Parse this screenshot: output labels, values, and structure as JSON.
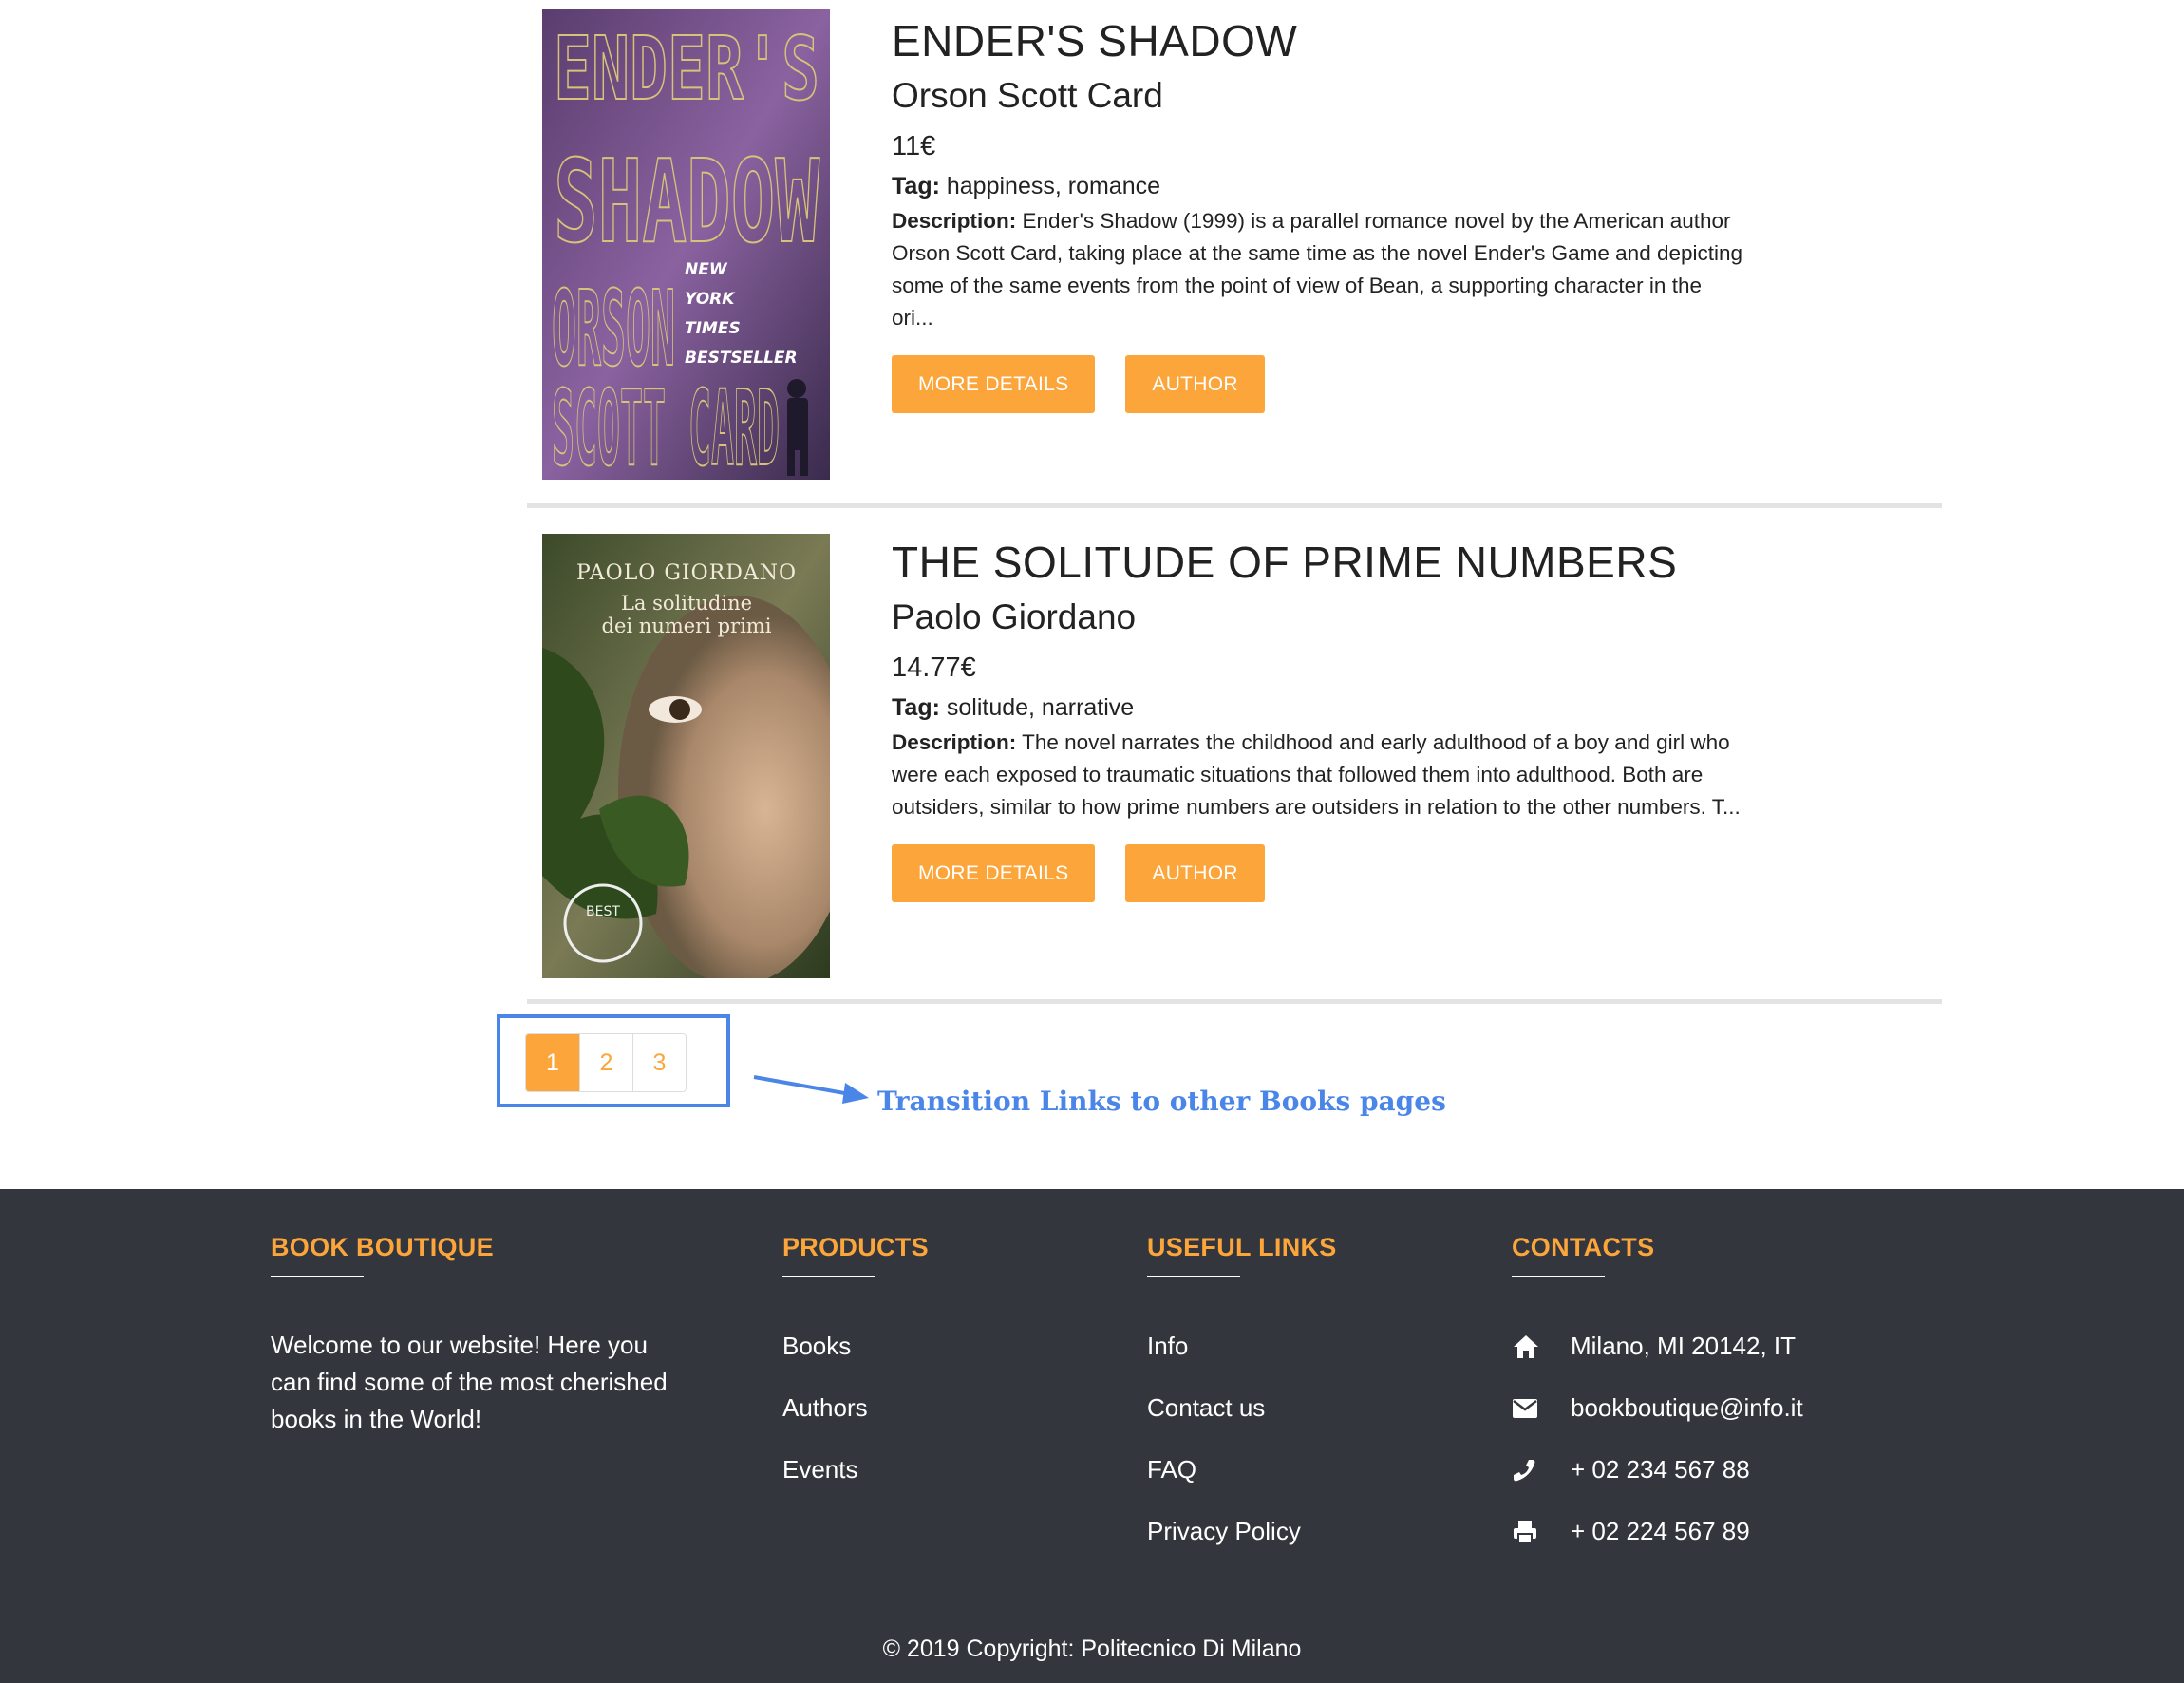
{
  "books": [
    {
      "title": "ENDER'S SHADOW",
      "author": "Orson Scott Card",
      "price": "11€",
      "tag_label": "Tag:",
      "tags": "happiness, romance",
      "desc_label": "Description:",
      "description": "Ender's Shadow (1999) is a parallel romance novel by the American author Orson Scott Card, taking place at the same time as the novel Ender's Game and depicting some of the same events from the point of view of Bean, a supporting character in the ori...",
      "cover_text": [
        "ENDER'S",
        "SHADOW",
        "ORSON",
        "SCOTT CARD",
        "NEW",
        "YORK",
        "TIMES",
        "BESTSELLER"
      ],
      "more_label": "MORE DETAILS",
      "author_btn_label": "AUTHOR"
    },
    {
      "title": "THE SOLITUDE OF PRIME NUMBERS",
      "author": "Paolo Giordano",
      "price": "14.77€",
      "tag_label": "Tag:",
      "tags": "solitude, narrative",
      "desc_label": "Description:",
      "description": "The novel narrates the childhood and early adulthood of a boy and girl who were each exposed to traumatic situations that followed them into adulthood. Both are outsiders, similar to how prime numbers are outsiders in relation to the other numbers. T...",
      "cover_text": [
        "PAOLO GIORDANO",
        "La solitudine",
        "dei numeri primi",
        "BEST"
      ],
      "more_label": "MORE DETAILS",
      "author_btn_label": "AUTHOR"
    }
  ],
  "pagination": {
    "pages": [
      "1",
      "2",
      "3"
    ],
    "active": "1"
  },
  "annotation": {
    "text": "Transition Links to other Books pages",
    "color": "#4a86e8"
  },
  "footer": {
    "about": {
      "heading": "BOOK BOUTIQUE",
      "text": "Welcome to our website! Here you can find some of the most cherished books in the World!"
    },
    "products": {
      "heading": "PRODUCTS",
      "items": [
        "Books",
        "Authors",
        "Events"
      ]
    },
    "useful_links": {
      "heading": "USEFUL LINKS",
      "items": [
        "Info",
        "Contact us",
        "FAQ",
        "Privacy Policy"
      ]
    },
    "contacts": {
      "heading": "CONTACTS",
      "items": [
        {
          "icon": "home-icon",
          "text": "Milano, MI 20142, IT"
        },
        {
          "icon": "envelope-icon",
          "text": "bookboutique@info.it"
        },
        {
          "icon": "phone-icon",
          "text": "+ 02 234 567 88"
        },
        {
          "icon": "print-icon",
          "text": "+ 02 224 567 89"
        }
      ]
    },
    "copyright": "© 2019 Copyright: Politecnico Di Milano"
  },
  "colors": {
    "accent": "#fba53b",
    "footer_bg": "#33373d",
    "annotation": "#4a86e8"
  }
}
